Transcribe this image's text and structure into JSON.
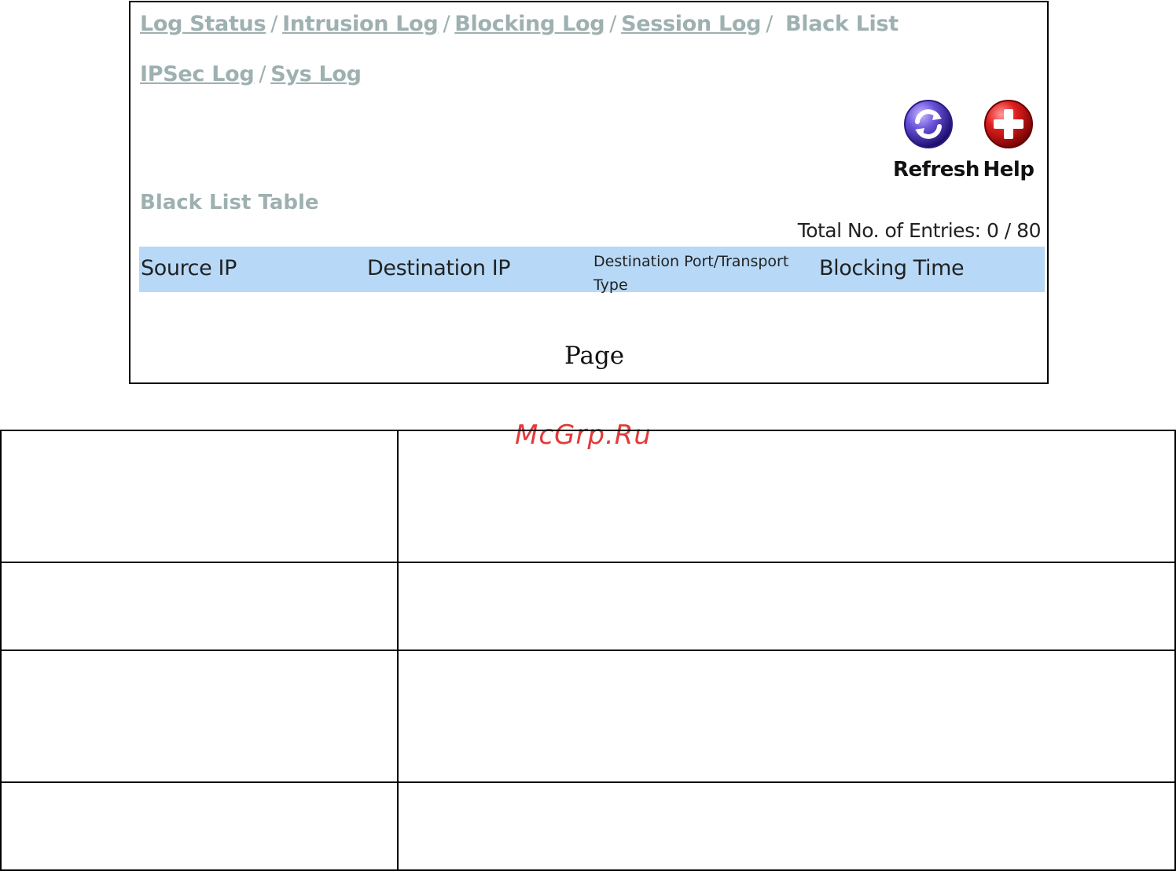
{
  "nav": {
    "links_row1": [
      "Log Status",
      "Intrusion Log",
      "Blocking Log",
      "Session Log"
    ],
    "current": "Black List",
    "links_row2": [
      "IPSec Log",
      "Sys Log"
    ],
    "separator": "/"
  },
  "toolbar": {
    "refresh_label": "Refresh",
    "help_label": "Help",
    "refresh_icon": "refresh-icon",
    "help_icon": "help-cross-icon"
  },
  "table": {
    "title": "Black List Table",
    "entries_label": "Total No. of Entries: 0  /  80",
    "columns": [
      "Source IP",
      "Destination IP",
      "Destination Port/Transport Type",
      "Blocking Time"
    ],
    "header_color": "#b7d9f7"
  },
  "pager": {
    "label": "Page"
  },
  "watermark": "McGrp.Ru",
  "doc_table": {
    "rows": [
      [
        "",
        ""
      ],
      [
        "",
        ""
      ],
      [
        "",
        ""
      ],
      [
        "",
        ""
      ]
    ]
  }
}
